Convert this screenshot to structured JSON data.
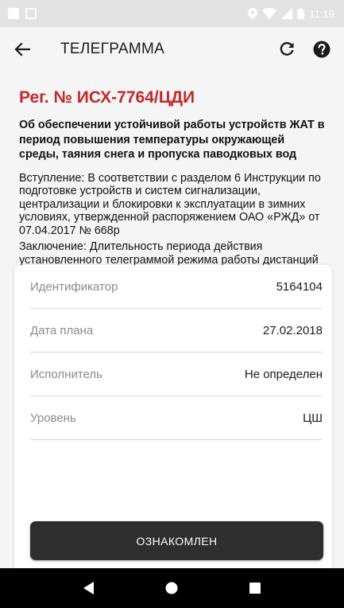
{
  "status_bar": {
    "time": "11:19"
  },
  "app_bar": {
    "title": "ТЕЛЕГРАММА"
  },
  "document": {
    "reg_number": "Рег. № ИСХ-7764/ЦДИ",
    "subject": "Об обеспечении устойчивой работы устройств ЖАТ в период повышения температуры окружающей среды, таяния снега и пропуска паводковых вод",
    "intro": "Вступление: В соответствии с разделом 6 Инструкции по подготовке устройств и систем сигнализации, централизации и блокировки к эксплуатации в зимних условиях, утвержденной распоряжением ОАО «РЖД» от 07.04.2017 № 668р",
    "conclusion": "Заключение: Длительность периода действия установленного телеграммой режима работы дистанций СЦБ при пропуске талых вод и таянии снега устанавливается Ш на основании прогнозов отдела гидрометеорологии ЦДИ."
  },
  "details": [
    {
      "label": "Идентификатор",
      "value": "5164104"
    },
    {
      "label": "Дата плана",
      "value": "27.02.2018"
    },
    {
      "label": "Исполнитель",
      "value": "Не определен"
    },
    {
      "label": "Уровень",
      "value": "ЦШ"
    }
  ],
  "acknowledge_button": "ОЗНАКОМЛЕН",
  "colors": {
    "accent_red": "#c4282c",
    "button_dark": "#2e2e2e"
  }
}
